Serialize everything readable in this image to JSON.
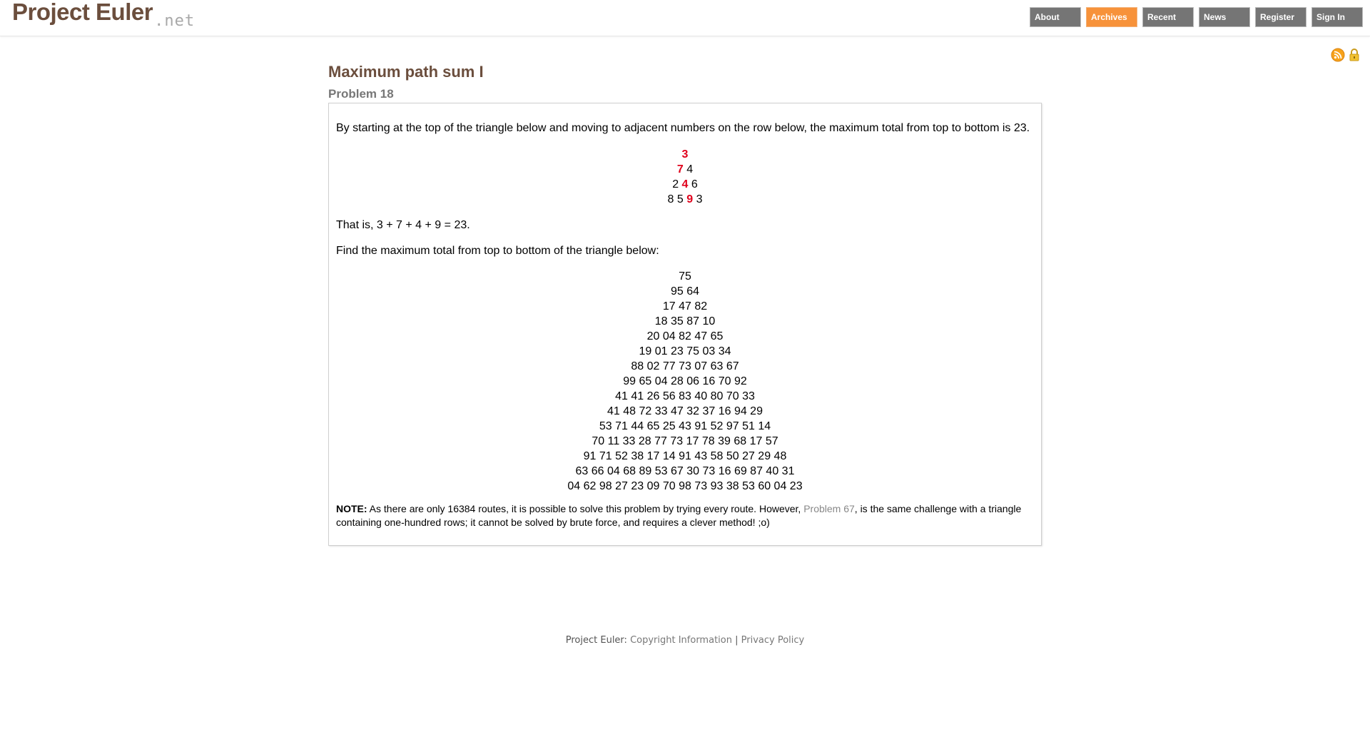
{
  "header": {
    "logo_main": "Project Euler",
    "logo_suffix": ".net",
    "nav": [
      {
        "label": "About",
        "active": false
      },
      {
        "label": "Archives",
        "active": true
      },
      {
        "label": "Recent",
        "active": false
      },
      {
        "label": "News",
        "active": false
      },
      {
        "label": "Register",
        "active": false
      },
      {
        "label": "Sign In",
        "active": false
      }
    ],
    "icons": [
      "rss-feed-icon",
      "lock-icon"
    ]
  },
  "problem": {
    "title": "Maximum path sum I",
    "number": "Problem 18",
    "intro": "By starting at the top of the triangle below and moving to adjacent numbers on the row below, the maximum total from top to bottom is 23.",
    "example_rows": [
      {
        "before": "",
        "red": "3",
        "after": ""
      },
      {
        "before": "",
        "red": "7",
        "after": " 4"
      },
      {
        "before": "2 ",
        "red": "4",
        "after": " 6"
      },
      {
        "before": "8 5 ",
        "red": "9",
        "after": " 3"
      }
    ],
    "that_is": "That is, 3 + 7 + 4 + 9 = 23.",
    "find": "Find the maximum total from top to bottom of the triangle below:",
    "triangle_rows": [
      "75",
      "95 64",
      "17 47 82",
      "18 35 87 10",
      "20 04 82 47 65",
      "19 01 23 75 03 34",
      "88 02 77 73 07 63 67",
      "99 65 04 28 06 16 70 92",
      "41 41 26 56 83 40 80 70 33",
      "41 48 72 33 47 32 37 16 94 29",
      "53 71 44 65 25 43 91 52 97 51 14",
      "70 11 33 28 77 73 17 78 39 68 17 57",
      "91 71 52 38 17 14 91 43 58 50 27 29 48",
      "63 66 04 68 89 53 67 30 73 16 69 87 40 31",
      "04 62 98 27 23 09 70 98 73 93 38 53 60 04 23"
    ],
    "note_label": "NOTE:",
    "note_before": " As there are only 16384 routes, it is possible to solve this problem by trying every route. However, ",
    "note_link": "Problem 67",
    "note_after": ", is the same challenge with a triangle containing one-hundred rows; it cannot be solved by brute force, and requires a clever method! ;o)"
  },
  "footer": {
    "label": "Project Euler: ",
    "copyright": "Copyright Information",
    "separator": " | ",
    "privacy": "Privacy Policy"
  },
  "colors": {
    "brand": "#6b4e3d",
    "nav_bg": "#757575",
    "nav_active": "#f7923a",
    "highlight": "#e0001b"
  }
}
